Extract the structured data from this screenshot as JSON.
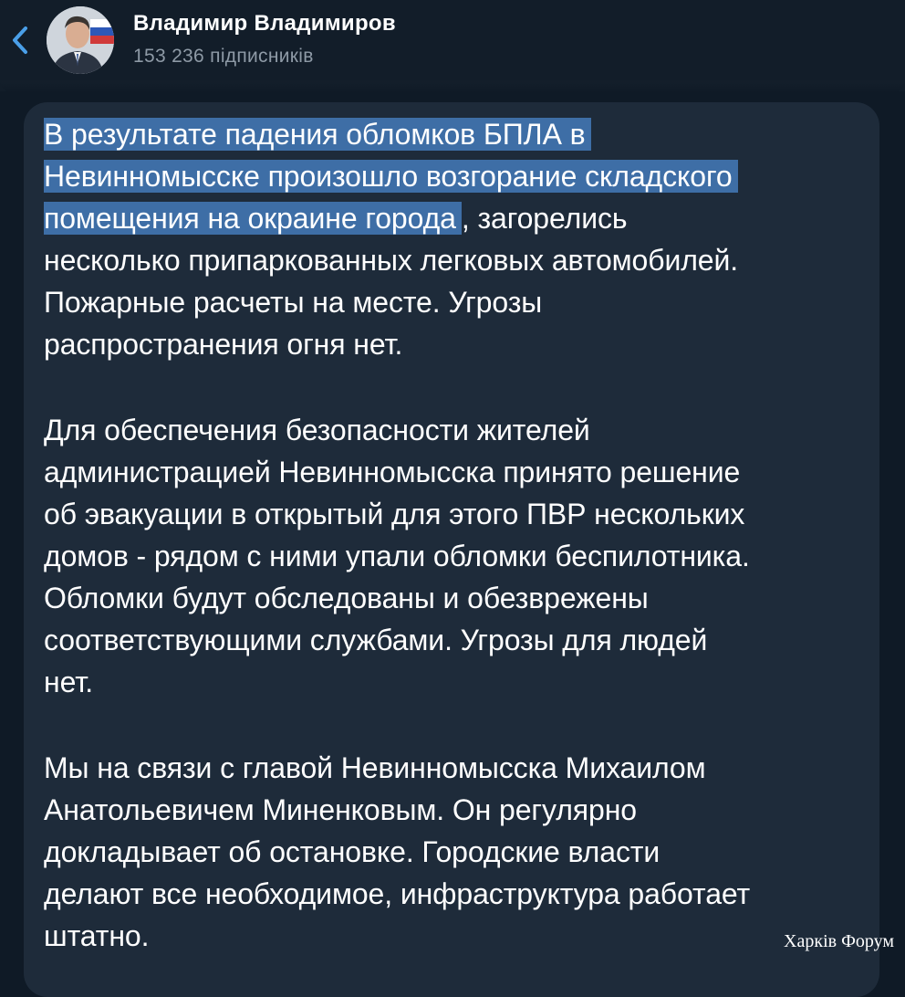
{
  "header": {
    "channel_name": "Владимир Владимиров",
    "subscribers": "153 236 підписників"
  },
  "icons": {
    "back": "chevron-left-icon",
    "avatar": "channel-avatar"
  },
  "colors": {
    "background": "#0f1a26",
    "bubble": "#1e2b3a",
    "highlight": "#3e6ea6",
    "accent": "#4a9fe8",
    "muted": "#8e9aa6"
  },
  "message": {
    "p1": {
      "l1": "В результате падения обломков БПЛА в",
      "l2": "Невинномысске произошло возгорание складского",
      "l3_highlight": "помещения на окраине города",
      "l3_rest": ",  загорелись",
      "l4": "несколько припаркованных легковых автомобилей.",
      "l5": "Пожарные расчеты на месте. Угрозы",
      "l6": "распространения огня нет."
    },
    "p2": {
      "l1": "Для обеспечения безопасности жителей",
      "l2": "администрацией Невинномысска принято решение",
      "l3": "об эвакуации в открытый для этого ПВР нескольких",
      "l4": "домов - рядом с ними упали обломки беспилотника.",
      "l5": "Обломки будут обследованы и обезврежены",
      "l6": "соответствующими службами. Угрозы для людей",
      "l7": "нет."
    },
    "p3": {
      "l1": "Мы на связи с главой Невинномысска Михаилом",
      "l2": "Анатольевичем Миненковым. Он регулярно",
      "l3": "докладывает об остановке. Городские власти",
      "l4": "делают все необходимое, инфраструктура работает",
      "l5": "штатно."
    }
  },
  "watermark": "Харків Форум"
}
